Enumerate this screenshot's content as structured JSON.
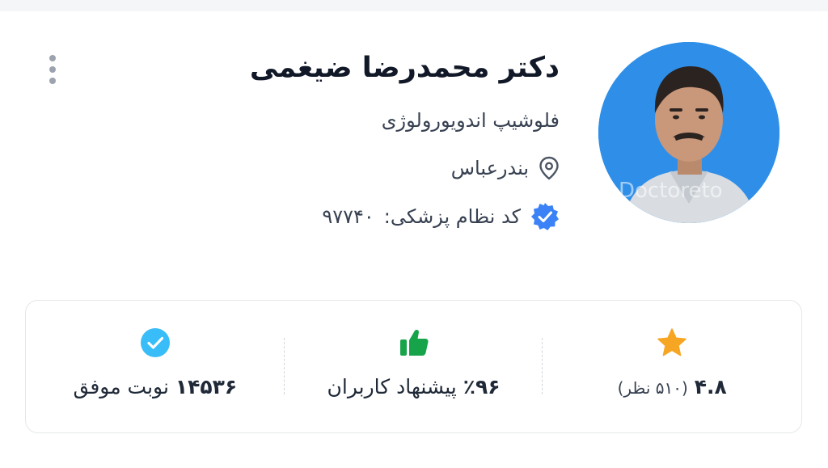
{
  "doctor": {
    "name": "دکتر محمدرضا ضیغمی",
    "specialty": "فلوشیپ اندویورولوژی",
    "city": "بندرعباس",
    "code_label": "کد نظام پزشکی:",
    "code_value": "۹۷۷۴۰",
    "photo_watermark": "Doctoreto"
  },
  "stats": {
    "rating": {
      "value": "۴.۸",
      "count": "(۵۱۰ نظر)"
    },
    "recommend": {
      "value": "٪۹۶",
      "label": "پیشنهاد کاربران"
    },
    "appointments": {
      "value": "۱۴۵۳۶",
      "label": "نوبت موفق"
    }
  },
  "icons": {
    "more": "more-vertical-icon",
    "location": "location-pin-icon",
    "verified": "verified-badge-icon",
    "star": "star-icon",
    "thumbs_up": "thumbs-up-icon",
    "check": "check-circle-icon"
  },
  "colors": {
    "avatar_bg": "#2f8fe8",
    "verified": "#3b82f6",
    "star": "#f6a623",
    "thumbs": "#16a34a",
    "check": "#38bdf8"
  }
}
